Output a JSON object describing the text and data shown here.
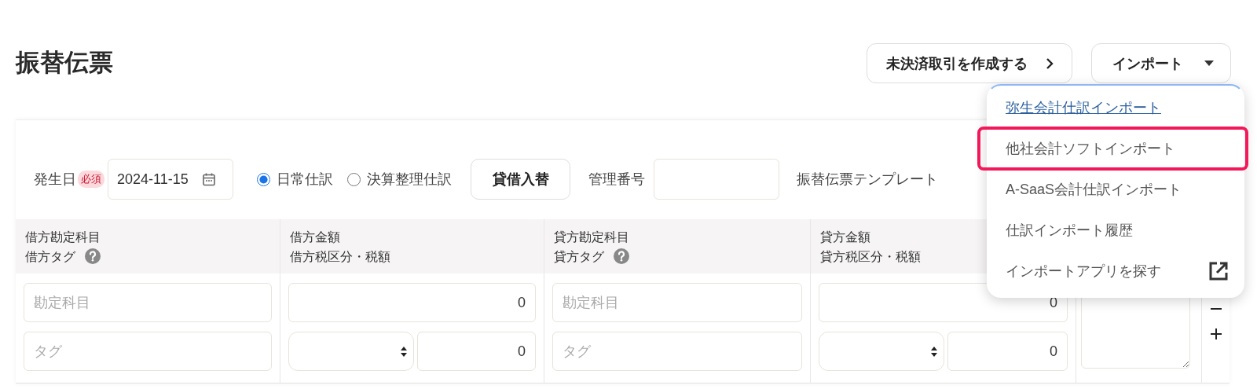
{
  "page": {
    "title": "振替伝票"
  },
  "header_buttons": [
    {
      "label": "未決済取引を作成する",
      "kind": "chevron"
    },
    {
      "label": "インポート",
      "kind": "dropdown",
      "expanded": true
    }
  ],
  "import_menu": {
    "items": [
      {
        "label": "弥生会計仕訳インポート",
        "kind": "link",
        "highlighted": false
      },
      {
        "label": "他社会計ソフトインポート",
        "kind": "plain",
        "highlighted": true
      },
      {
        "label": "A-SaaS会計仕訳インポート",
        "kind": "plain",
        "highlighted": false
      },
      {
        "label": "仕訳インポート履歴",
        "kind": "plain",
        "highlighted": false
      },
      {
        "label": "インポートアプリを探す",
        "kind": "external",
        "highlighted": false
      }
    ]
  },
  "form": {
    "date_label": "発生日",
    "required_badge": "必須",
    "date_value": "2024-11-15",
    "entry_types": [
      {
        "label": "日常仕訳",
        "selected": true
      },
      {
        "label": "決算整理仕訳",
        "selected": false
      }
    ],
    "swap_button": "貸借入替",
    "management_number_label": "管理番号",
    "template_label": "振替伝票テンプレート"
  },
  "table": {
    "columns": [
      {
        "line_1": "借方勘定科目",
        "line_2": "借方タグ",
        "help": true
      },
      {
        "line_1": "借方金額",
        "line_2": "借方税区分・税額",
        "help": false
      },
      {
        "line_1": "貸方勘定科目",
        "line_2": "貸方タグ",
        "help": true
      },
      {
        "line_1": "貸方金額",
        "line_2": "貸方税区分・税額",
        "help": false
      }
    ],
    "rows": [
      {
        "debit_account_placeholder": "勘定科目",
        "debit_tag_placeholder": "タグ",
        "debit_amount": "0",
        "debit_tax": "0",
        "credit_account_placeholder": "勘定科目",
        "credit_tag_placeholder": "タグ",
        "credit_amount": "0",
        "credit_tax": "0"
      }
    ]
  }
}
